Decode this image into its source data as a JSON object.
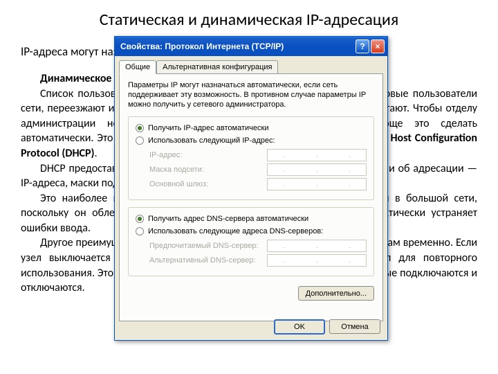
{
  "page": {
    "title": "Статическая и динамическая IP-адресация"
  },
  "bg": {
    "intro": "IP-адреса могут назначаться статически или динамически.",
    "heading": "Динамическое назначение",
    "p1a": "Список пользователей локальной сети часто меняется. Добавляются новые пользователи сети, переезжают и возвращаются. Другие устанавливают программы, работают. Чтобы отделу администрации не приходилось вручную назначать IP-адреса, проще это сделать автоматически. Это делается с помощью протокола под названием ",
    "p1b": "Dynamic Host Configuration Protocol (DHCP)",
    "p1c": ".",
    "p2": "DHCP предоставляет механизм автоматического присвоения информации об адресации — IP-адреса, маски подсети, основного шлюза и других параметров.",
    "p3": "Это наиболее предпочтительный метод присвоения IP-адресов узлам в большой сети, поскольку он облегчает работу специалистов службы поддержки и практически устраняет ошибки ввода.",
    "p4": "Другое преимущество DHCP состоит в том, что адреса присваиваются узлам временно. Если узел выключается или уходит из сети, его адрес возвращается в пул для повторного использования. Это особенно полезно для мобильных пользователей, которые подключаются и отключаются."
  },
  "dialog": {
    "title": "Свойства: Протокол Интернета (TCP/IP)",
    "help": "?",
    "close": "×",
    "tabs": {
      "general": "Общие",
      "alt": "Альтернативная конфигурация"
    },
    "desc": "Параметры IP могут назначаться автоматически, если сеть поддерживает эту возможность. В противном случае параметры IP можно получить у сетевого администратора.",
    "ip_group": {
      "auto": "Получить IP-адрес автоматически",
      "manual": "Использовать следующий IP-адрес:",
      "ip": "IP-адрес:",
      "mask": "Маска подсети:",
      "gateway": "Основной шлюз:"
    },
    "dns_group": {
      "auto": "Получить адрес DNS-сервера автоматически",
      "manual": "Использовать следующие адреса DNS-серверов:",
      "pref": "Предпочитаемый DNS-сервер:",
      "alt": "Альтернативный DNS-сервер:"
    },
    "advanced": "Дополнительно...",
    "ok": "OK",
    "cancel": "Отмена"
  }
}
